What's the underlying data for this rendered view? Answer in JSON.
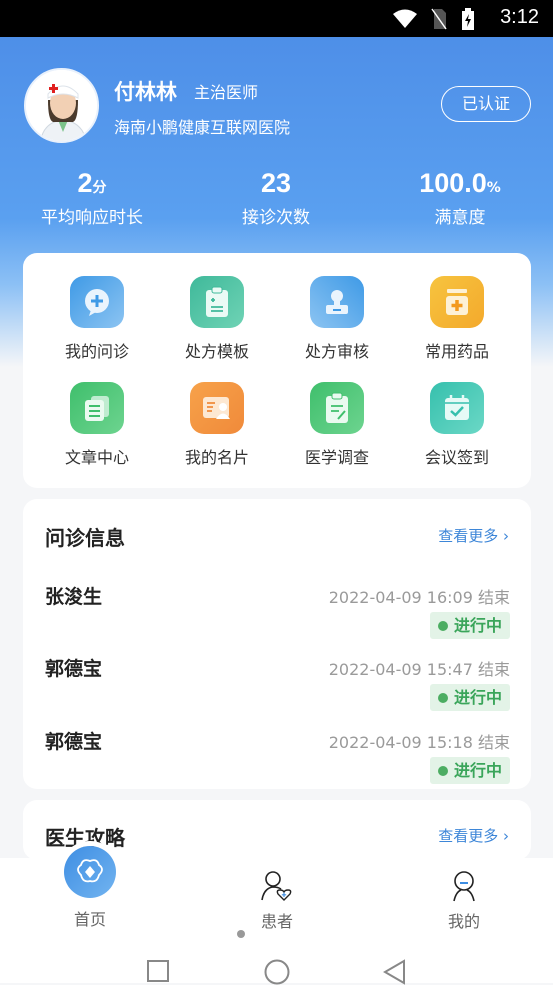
{
  "status_bar": {
    "time": "3:12",
    "icons": [
      "wifi-icon",
      "no-sim-icon",
      "battery-charging-icon"
    ]
  },
  "profile": {
    "name": "付林林",
    "title": "主治医师",
    "hospital": "海南小鹏健康互联网医院",
    "verified_label": "已认证"
  },
  "stats": [
    {
      "value": "2",
      "unit": "分",
      "label": "平均响应时长"
    },
    {
      "value": "23",
      "unit": "",
      "label": "接诊次数"
    },
    {
      "value": "100.0",
      "unit": "%",
      "label": "满意度"
    }
  ],
  "shortcuts": [
    {
      "label": "我的问诊",
      "icon": "chat-plus-icon",
      "color": "#4fa3e8"
    },
    {
      "label": "处方模板",
      "icon": "clipboard-icon",
      "color": "#45bf9c"
    },
    {
      "label": "处方审核",
      "icon": "stamp-icon",
      "color": "#4fa3e8"
    },
    {
      "label": "常用药品",
      "icon": "medicine-jar-icon",
      "color": "#f5b336"
    },
    {
      "label": "文章中心",
      "icon": "documents-icon",
      "color": "#4cc276"
    },
    {
      "label": "我的名片",
      "icon": "business-card-icon",
      "color": "#f5a04a"
    },
    {
      "label": "医学调查",
      "icon": "survey-icon",
      "color": "#4cc276"
    },
    {
      "label": "会议签到",
      "icon": "calendar-check-icon",
      "color": "#3fc6b0"
    }
  ],
  "consult": {
    "title": "问诊信息",
    "more_label": "查看更多",
    "items": [
      {
        "name": "张浚生",
        "time": "2022-04-09 16:09 结束",
        "status": "进行中"
      },
      {
        "name": "郭德宝",
        "time": "2022-04-09 15:47 结束",
        "status": "进行中"
      },
      {
        "name": "郭德宝",
        "time": "2022-04-09 15:18 结束",
        "status": "进行中"
      }
    ]
  },
  "guide": {
    "title": "医生攻略",
    "more_label": "查看更多"
  },
  "tabbar": [
    {
      "label": "首页",
      "icon": "home-icon",
      "active": true
    },
    {
      "label": "患者",
      "icon": "patient-icon",
      "active": false
    },
    {
      "label": "我的",
      "icon": "profile-icon",
      "active": false
    }
  ],
  "colors": {
    "primary": "#4e8fe8",
    "link": "#3d86d8",
    "status_green": "#3aa55a"
  }
}
